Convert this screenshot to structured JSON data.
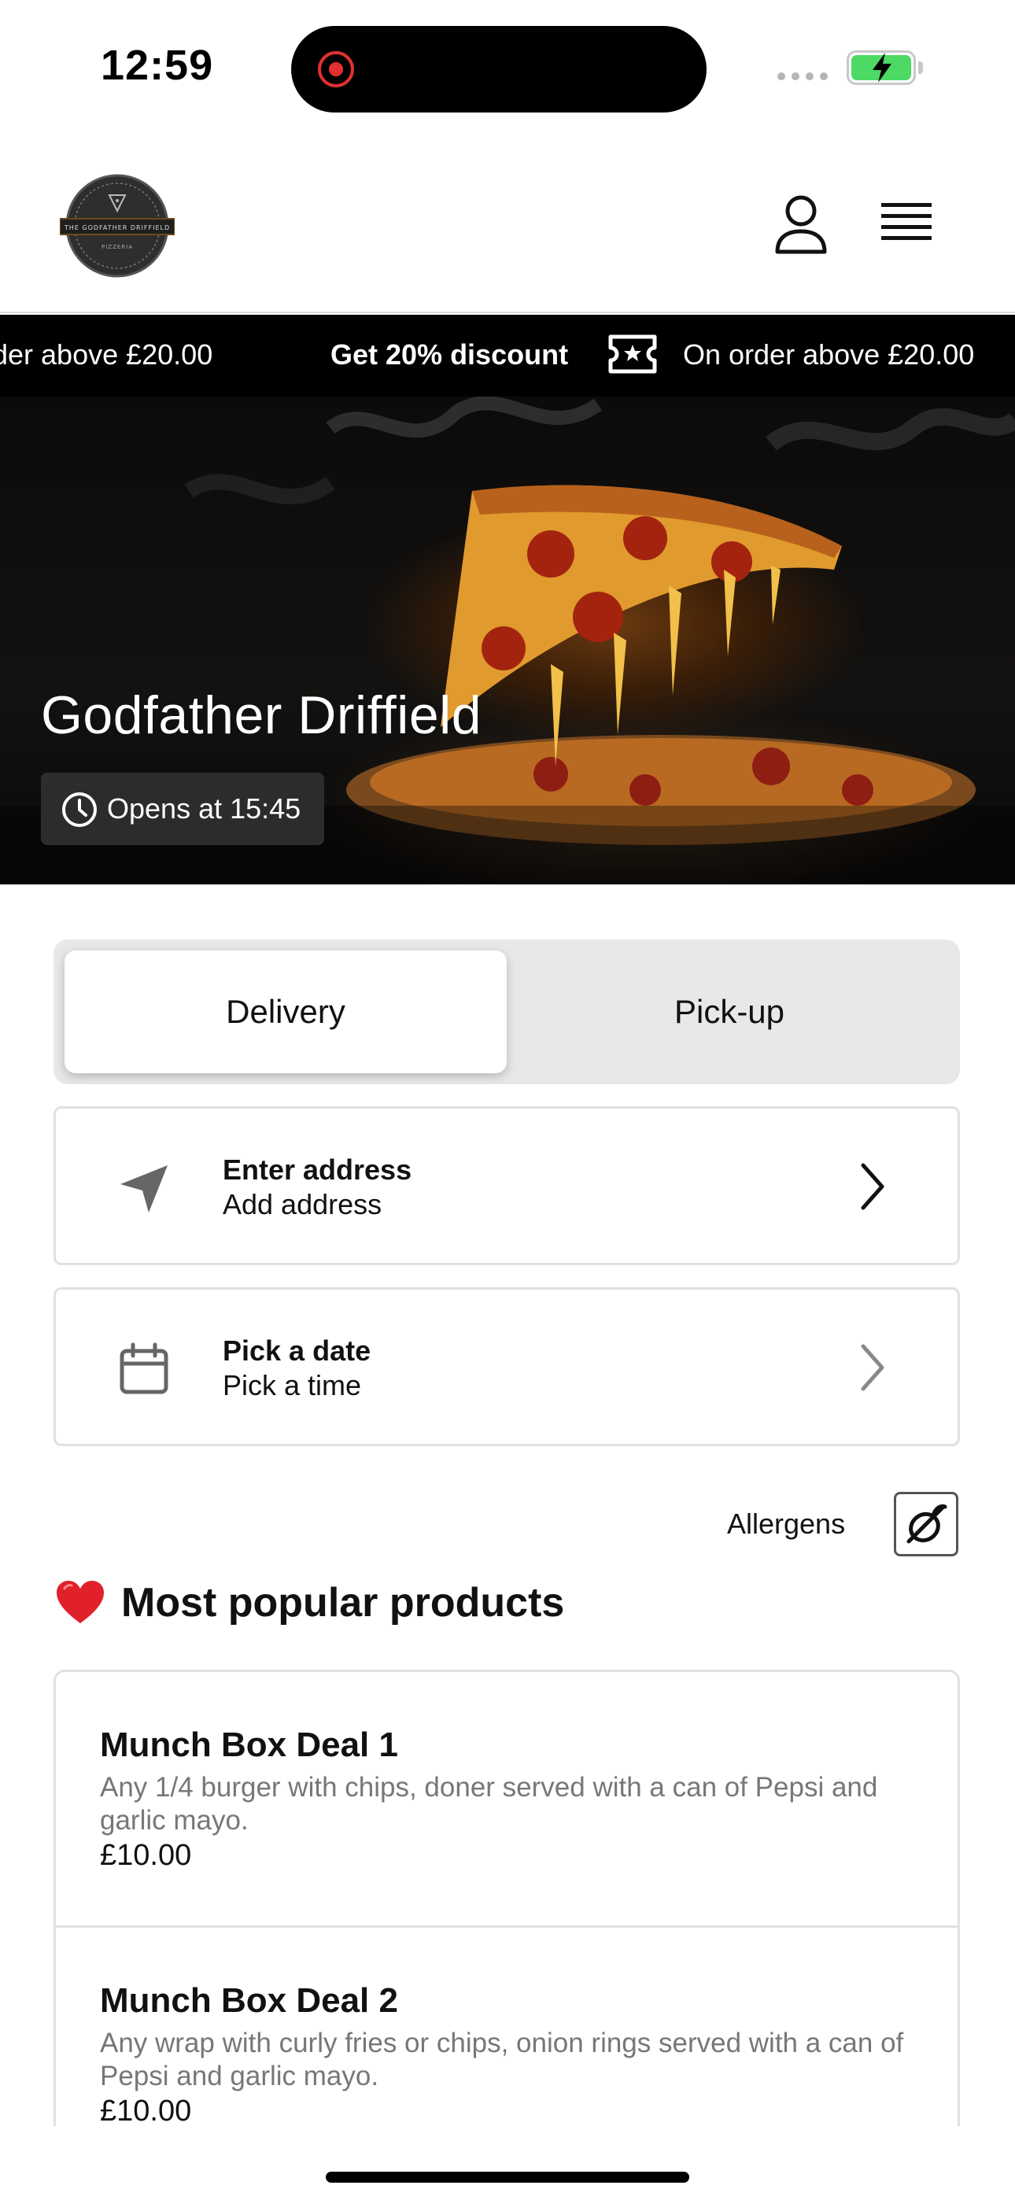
{
  "status_bar": {
    "time": "12:59"
  },
  "header": {
    "logo_text": "THE GODFATHER DRIFFIELD PIZZERIA",
    "icons": [
      "user-icon",
      "hamburger-menu-icon"
    ]
  },
  "promo_ticker": {
    "items": [
      "rder above £20.00",
      "Get 20% discount",
      "On order above £20.00"
    ],
    "icon": "ticket-star-icon"
  },
  "hero": {
    "title": "Godfather Driffield",
    "hours": "Opens at 15:45",
    "icon": "clock-icon"
  },
  "order_mode": {
    "delivery_label": "Delivery",
    "pickup_label": "Pick-up",
    "selected": "Delivery"
  },
  "address_card": {
    "title": "Enter address",
    "subtitle": "Add address",
    "icon": "location-arrow-icon"
  },
  "schedule_card": {
    "title": "Pick a date",
    "subtitle": "Pick a time",
    "icon": "calendar-icon"
  },
  "allergens": {
    "label": "Allergens",
    "icon": "allergen-icon"
  },
  "popular": {
    "heading": "Most popular products",
    "icon": "heart-icon",
    "products": [
      {
        "name": "Munch Box Deal 1",
        "description": "Any 1/4 burger with chips, doner served with a can of Pepsi and garlic mayo.",
        "price": "£10.00"
      },
      {
        "name": "Munch Box Deal 2",
        "description": "Any wrap with curly fries or chips, onion rings served with a can of Pepsi and garlic mayo.",
        "price": "£10.00"
      }
    ]
  },
  "colors": {
    "accent_dark": "#000000",
    "battery_green": "#4cd964",
    "record_red": "#e23030",
    "heart_red": "#e0202a",
    "muted_text": "#777777",
    "border": "#e1e1e1"
  }
}
